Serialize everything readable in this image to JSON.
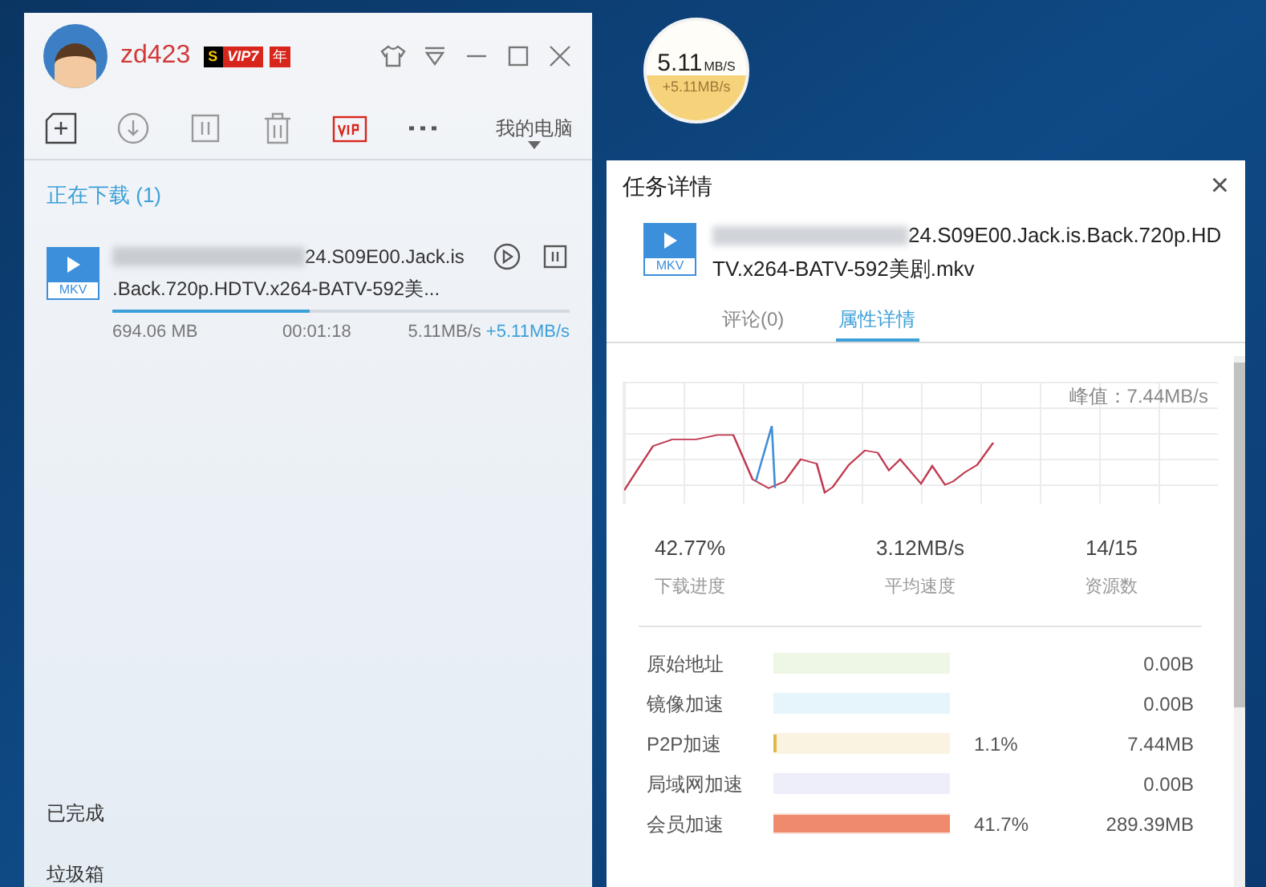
{
  "window": {
    "username": "zd423",
    "vip_mark": "S",
    "vip_badge": "VIP7",
    "year_badge": "年",
    "toolbar_location": "我的电脑"
  },
  "downloading": {
    "heading": "正在下载 (1)",
    "items": [
      {
        "type_label": "MKV",
        "name_line_1": "24.S09E00.Jack.is",
        "name_line_2": ".Back.720p.HDTV.x264-BATV-592美...",
        "size": "694.06 MB",
        "time": "00:01:18",
        "speed": "5.11MB/s",
        "boost": "+5.11MB/s",
        "level": 0.43
      }
    ]
  },
  "sidebar": {
    "items": [
      {
        "label": "已完成"
      },
      {
        "label": "垃圾箱"
      }
    ]
  },
  "speed_ball": {
    "speed": "5.11",
    "unit": "MB/S",
    "boost": "+5.11MB/s"
  },
  "detail": {
    "title": "任务详情",
    "close": "×",
    "type_label": "MKV",
    "file_name_line_1": "24.S09E00.Jack.is.Back.720p.HD",
    "file_name_line_2": "TV.x264-BATV-592美剧.mkv",
    "tabs": [
      {
        "label": "评论(0)",
        "selected": false
      },
      {
        "label": "属性详情",
        "selected": true
      }
    ],
    "peak": "峰值：7.44MB/s",
    "stats": [
      {
        "value": "42.77%",
        "label": "下载进度"
      },
      {
        "value": "3.12MB/s",
        "label": "平均速度"
      },
      {
        "value": "14/15",
        "label": "资源数"
      }
    ],
    "sources": [
      {
        "label": "原始地址",
        "color": "#eef7e6",
        "size": "0.00B"
      },
      {
        "label": "镜像加速",
        "color": "#e6f4fb",
        "size": "0.00B"
      },
      {
        "label": "P2P加速",
        "color": "#fbf3e2",
        "level": 0.02,
        "percent": "1.1%",
        "size": "7.44MB"
      },
      {
        "label": "局域网加速",
        "color": "#eeeefb",
        "size": "0.00B"
      },
      {
        "label": "会员加速",
        "color": "#fbe1d8",
        "level": 1,
        "percent": "41.7%",
        "size": "289.39MB"
      }
    ]
  }
}
